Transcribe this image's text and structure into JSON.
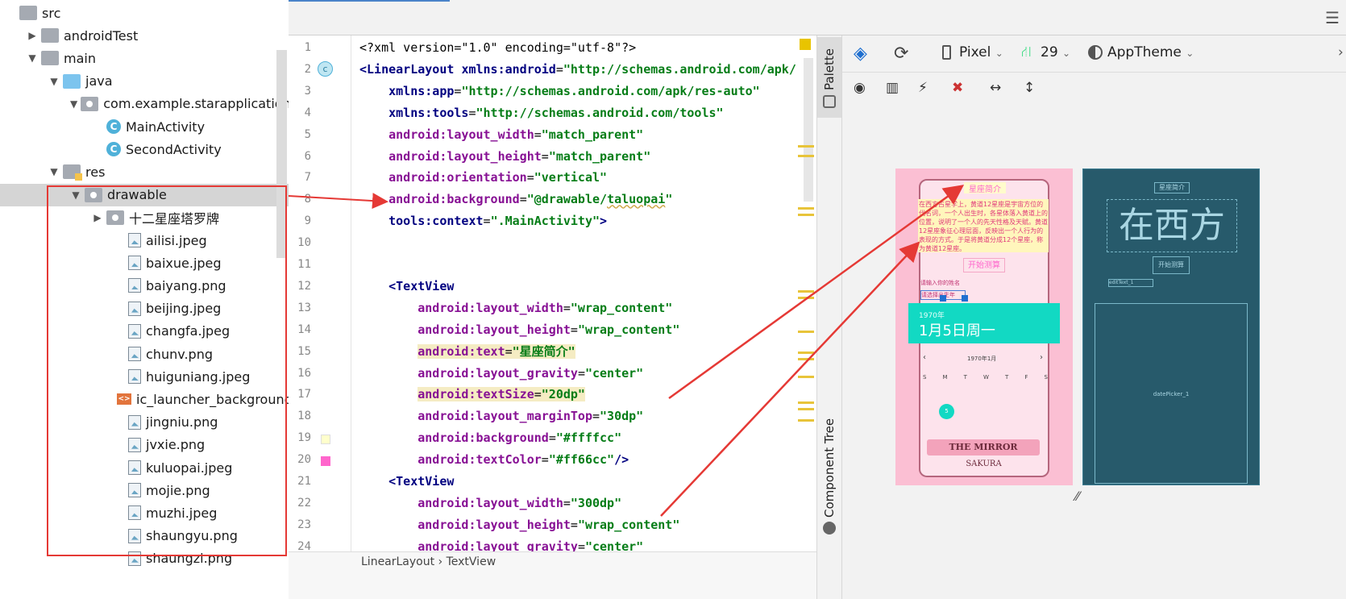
{
  "project_tree": [
    {
      "label": "src",
      "indent": 0,
      "arrow": "",
      "icon": "folder"
    },
    {
      "label": "androidTest",
      "indent": 1,
      "arrow": "▶",
      "icon": "folder"
    },
    {
      "label": "main",
      "indent": 1,
      "arrow": "▼",
      "icon": "folder"
    },
    {
      "label": "java",
      "indent": 2,
      "arrow": "▼",
      "icon": "folder-blue"
    },
    {
      "label": "com.example.starapplication",
      "indent": 3,
      "arrow": "▼",
      "icon": "package"
    },
    {
      "label": "MainActivity",
      "indent": 4,
      "arrow": "",
      "icon": "class"
    },
    {
      "label": "SecondActivity",
      "indent": 4,
      "arrow": "",
      "icon": "class"
    },
    {
      "label": "res",
      "indent": 2,
      "arrow": "▼",
      "icon": "folder-res"
    },
    {
      "label": "drawable",
      "indent": 3,
      "arrow": "▼",
      "icon": "package",
      "selected": true
    },
    {
      "label": "十二星座塔罗牌",
      "indent": 4,
      "arrow": "▶",
      "icon": "package"
    },
    {
      "label": "ailisi.jpeg",
      "indent": 5,
      "arrow": "",
      "icon": "image"
    },
    {
      "label": "baixue.jpeg",
      "indent": 5,
      "arrow": "",
      "icon": "image"
    },
    {
      "label": "baiyang.png",
      "indent": 5,
      "arrow": "",
      "icon": "image"
    },
    {
      "label": "beijing.jpeg",
      "indent": 5,
      "arrow": "",
      "icon": "image"
    },
    {
      "label": "changfa.jpeg",
      "indent": 5,
      "arrow": "",
      "icon": "image"
    },
    {
      "label": "chunv.png",
      "indent": 5,
      "arrow": "",
      "icon": "image"
    },
    {
      "label": "huiguniang.jpeg",
      "indent": 5,
      "arrow": "",
      "icon": "image"
    },
    {
      "label": "ic_launcher_background.xml",
      "indent": 5,
      "arrow": "",
      "icon": "xml"
    },
    {
      "label": "jingniu.png",
      "indent": 5,
      "arrow": "",
      "icon": "image"
    },
    {
      "label": "jvxie.png",
      "indent": 5,
      "arrow": "",
      "icon": "image"
    },
    {
      "label": "kuluopai.jpeg",
      "indent": 5,
      "arrow": "",
      "icon": "image"
    },
    {
      "label": "mojie.png",
      "indent": 5,
      "arrow": "",
      "icon": "image"
    },
    {
      "label": "muzhi.jpeg",
      "indent": 5,
      "arrow": "",
      "icon": "image"
    },
    {
      "label": "shaungyu.png",
      "indent": 5,
      "arrow": "",
      "icon": "image"
    },
    {
      "label": "shaungzi.png",
      "indent": 5,
      "arrow": "",
      "icon": "image"
    }
  ],
  "line_numbers": [
    "1",
    "2",
    "3",
    "4",
    "5",
    "6",
    "7",
    "8",
    "9",
    "10",
    "11",
    "12",
    "13",
    "14",
    "15",
    "16",
    "17",
    "18",
    "19",
    "20",
    "21",
    "22",
    "23",
    "24"
  ],
  "code_lines": [
    [
      {
        "t": "<?xml version=\"1.0\" encoding=\"utf-8\"?>",
        "c": ""
      }
    ],
    [
      {
        "t": "<LinearLayout ",
        "c": "tag"
      },
      {
        "t": "xmlns:android",
        "c": "ns"
      },
      {
        "t": "=",
        "c": ""
      },
      {
        "t": "\"http://schemas.android.com/apk/",
        "c": "val"
      }
    ],
    [
      {
        "t": "    xmlns:app",
        "c": "ns"
      },
      {
        "t": "=",
        "c": ""
      },
      {
        "t": "\"http://schemas.android.com/apk/res-auto\"",
        "c": "val"
      }
    ],
    [
      {
        "t": "    xmlns:tools",
        "c": "ns"
      },
      {
        "t": "=",
        "c": ""
      },
      {
        "t": "\"http://schemas.android.com/tools\"",
        "c": "val"
      }
    ],
    [
      {
        "t": "    android:layout_width",
        "c": "attr"
      },
      {
        "t": "=",
        "c": ""
      },
      {
        "t": "\"match_parent\"",
        "c": "val"
      }
    ],
    [
      {
        "t": "    android:layout_height",
        "c": "attr"
      },
      {
        "t": "=",
        "c": ""
      },
      {
        "t": "\"match_parent\"",
        "c": "val"
      }
    ],
    [
      {
        "t": "    android:orientation",
        "c": "attr"
      },
      {
        "t": "=",
        "c": ""
      },
      {
        "t": "\"vertical\"",
        "c": "val"
      }
    ],
    [
      {
        "t": "    android:background",
        "c": "attr"
      },
      {
        "t": "=",
        "c": ""
      },
      {
        "t": "\"@drawable/",
        "c": "val"
      },
      {
        "t": "taluopai",
        "c": "val uline"
      },
      {
        "t": "\"",
        "c": "val"
      }
    ],
    [
      {
        "t": "    tools:context",
        "c": "ns"
      },
      {
        "t": "=",
        "c": ""
      },
      {
        "t": "\".MainActivity\"",
        "c": "val"
      },
      {
        "t": ">",
        "c": "tag"
      }
    ],
    [
      {
        "t": "",
        "c": ""
      }
    ],
    [
      {
        "t": "",
        "c": ""
      }
    ],
    [
      {
        "t": "    <TextView",
        "c": "tag"
      }
    ],
    [
      {
        "t": "        android:layout_width",
        "c": "attr"
      },
      {
        "t": "=",
        "c": ""
      },
      {
        "t": "\"wrap_content\"",
        "c": "val"
      }
    ],
    [
      {
        "t": "        android:layout_height",
        "c": "attr"
      },
      {
        "t": "=",
        "c": ""
      },
      {
        "t": "\"wrap_content\"",
        "c": "val"
      }
    ],
    [
      {
        "t": "        ",
        "c": ""
      },
      {
        "t": "android:text",
        "c": "attr hl"
      },
      {
        "t": "=",
        "c": "hl"
      },
      {
        "t": "\"星座简介\"",
        "c": "val hl"
      }
    ],
    [
      {
        "t": "        android:layout_gravity",
        "c": "attr"
      },
      {
        "t": "=",
        "c": ""
      },
      {
        "t": "\"center\"",
        "c": "val"
      }
    ],
    [
      {
        "t": "        ",
        "c": ""
      },
      {
        "t": "android:textSize",
        "c": "attr hl"
      },
      {
        "t": "=",
        "c": "hl"
      },
      {
        "t": "\"20dp\"",
        "c": "val hl"
      }
    ],
    [
      {
        "t": "        android:layout_marginTop",
        "c": "attr"
      },
      {
        "t": "=",
        "c": ""
      },
      {
        "t": "\"30dp\"",
        "c": "val"
      }
    ],
    [
      {
        "t": "        android:background",
        "c": "attr"
      },
      {
        "t": "=",
        "c": ""
      },
      {
        "t": "\"#ffffcc\"",
        "c": "val"
      }
    ],
    [
      {
        "t": "        android:textColor",
        "c": "attr"
      },
      {
        "t": "=",
        "c": ""
      },
      {
        "t": "\"#ff66cc\"",
        "c": "val"
      },
      {
        "t": "/>",
        "c": "tag"
      }
    ],
    [
      {
        "t": "    <TextView",
        "c": "tag"
      }
    ],
    [
      {
        "t": "        android:layout_width",
        "c": "attr"
      },
      {
        "t": "=",
        "c": ""
      },
      {
        "t": "\"300dp\"",
        "c": "val"
      }
    ],
    [
      {
        "t": "        android:layout_height",
        "c": "attr"
      },
      {
        "t": "=",
        "c": ""
      },
      {
        "t": "\"wrap_content\"",
        "c": "val"
      }
    ],
    [
      {
        "t": "        android:layout_gravity",
        "c": "attr"
      },
      {
        "t": "=",
        "c": ""
      },
      {
        "t": "\"center\"",
        "c": "val"
      }
    ]
  ],
  "breadcrumb": "LinearLayout  ›  TextView",
  "side_tabs": {
    "palette": "Palette",
    "component_tree": "Component Tree"
  },
  "toolbar": {
    "device": "Pixel",
    "api": "29",
    "theme": "AppTheme"
  },
  "preview": {
    "header_text": "星座简介",
    "intro_text": "在西方占星学上，黄道12星座是宇宙方位的代名词，一个人出生时，各星体落入黄道上的位置，说明了一个人的先天性格及天赋。黄道12星座象征心理层面，反映出一个人行为的表现的方式。于是将黄道分成12个星座，称为黄道12星座。",
    "start_button": "开始测算",
    "name_prompt": "请输入你的姓名",
    "select_prompt": "请选择出生年",
    "year": "1970年",
    "date": "1月5日周一",
    "month_title": "1970年1月",
    "weekdays": [
      "S",
      "M",
      "T",
      "W",
      "T",
      "F",
      "S"
    ],
    "selected_day": "5",
    "mirror": "THE MIRROR",
    "sakura": "SAKURA"
  },
  "blueprint": {
    "header": "星座简介",
    "big": "在西方",
    "button": "开始测算",
    "edit": "editText_1",
    "picker": "datePicker_1"
  },
  "colors": {
    "accent": "#12d9c3",
    "pink": "#ff66cc",
    "yellow": "#ffffcc",
    "red": "#e53935"
  }
}
